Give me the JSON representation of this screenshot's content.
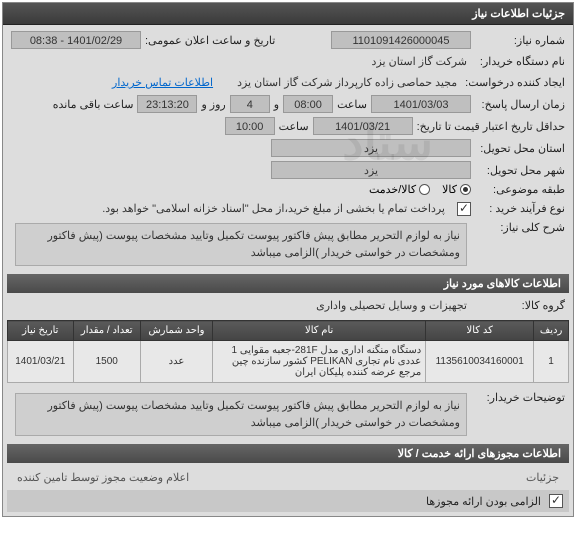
{
  "main": {
    "title": "جزئیات اطلاعات نیاز",
    "rows": {
      "need_no_label": "شماره نیاز:",
      "need_no": "1101091426000045",
      "announce_label": "تاریخ و ساعت اعلان عمومی:",
      "announce_val": "1401/02/29 - 08:38",
      "buyer_org_label": "نام دستگاه خریدار:",
      "buyer_org": "شرکت گاز استان یزد",
      "requester_label": "ایجاد کننده درخواست:",
      "requester": "مجید حماصی زاده کارپرداز شرکت گاز استان یزد",
      "contact_link": "اطلاعات تماس خریدار",
      "reply_deadline_label": "زمان ارسال پاسخ:",
      "reply_date": "1401/03/03",
      "time_lbl": "ساعت",
      "reply_time": "08:00",
      "day_lbl": "و",
      "days": "4",
      "days_unit": "روز و",
      "remaining": "23:13:20",
      "remaining_lbl": "ساعت باقی مانده",
      "credit_hist_label": "حداقل تاریخ اعتبار قیمت تا تاریخ:",
      "credit_date": "1401/03/21",
      "credit_time": "10:00",
      "province_label": "استان محل تحویل:",
      "province": "یزد",
      "city_label": "شهر محل تحویل:",
      "city": "یزد",
      "class_label": "طبقه موضوعی:",
      "class_goods": "کالا",
      "class_service": "کالا/خدمت",
      "purchase_type_label": "نوع فرآیند خرید :",
      "purchase_type_note": "پرداخت تمام یا بخشی از مبلغ خرید،از محل \"اسناد خزانه اسلامی\" خواهد بود."
    },
    "need_desc_label": "شرح کلی نیاز:",
    "need_desc": "نیاز به لوازم التحریر مطابق پیش فاکتور پیوست تکمیل وتایید مشخصات پیوست (پیش فاکتور ومشخصات در خواستی خریدار )الزامی میباشد"
  },
  "goods": {
    "header": "اطلاعات کالاهای مورد نیاز",
    "group_label": "گروه کالا:",
    "group_val": "تجهیزات و وسایل تحصیلی واداری",
    "cols": {
      "row": "ردیف",
      "code": "کد کالا",
      "name": "نام کالا",
      "unit": "واحد شمارش",
      "qty": "تعداد / مقدار",
      "date": "تاریخ نیاز"
    },
    "items": [
      {
        "row": "1",
        "code": "1135610034160001",
        "name": "دستگاه منگنه اداری مدل 281F-جعبه مقوایی 1 عددی نام تجاری PELIKAN کشور سازنده چین مرجع عرضه کننده پلیکان ایران",
        "unit": "عدد",
        "qty": "1500",
        "date": "1401/03/21"
      }
    ],
    "buyer_notes_label": "توضیحات خریدار:",
    "buyer_notes": "نیاز به لوازم التحریر مطابق پیش فاکتور پیوست تکمیل وتایید مشخصات پیوست (پیش فاکتور ومشخصات در خواستی خریدار )الزامی میباشد"
  },
  "permits_header": "اطلاعات مجوزهای ارائه خدمت / کالا",
  "footer": {
    "right": "اعلام وضعیت مجوز توسط تامین کننده",
    "left": "جزئیات"
  },
  "bottom": {
    "has_permit_label": "الزامی بودن ارائه مجوزها"
  }
}
